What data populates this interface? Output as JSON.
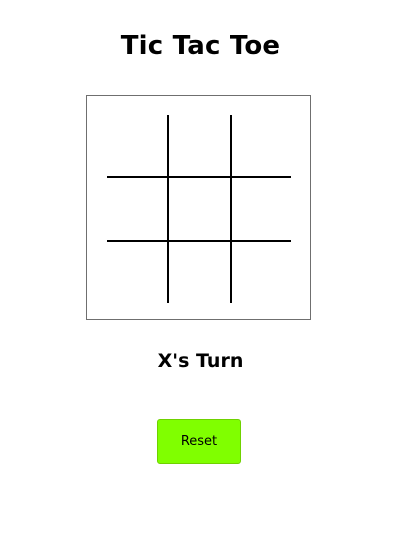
{
  "game": {
    "title": "Tic Tac Toe",
    "status": "X's Turn",
    "reset_label": "Reset",
    "board": [
      "",
      "",
      "",
      "",
      "",
      "",
      "",
      "",
      ""
    ]
  },
  "colors": {
    "reset_button": "#80ff00",
    "board_border": "#6f6f6f",
    "grid_lines": "#000000"
  }
}
